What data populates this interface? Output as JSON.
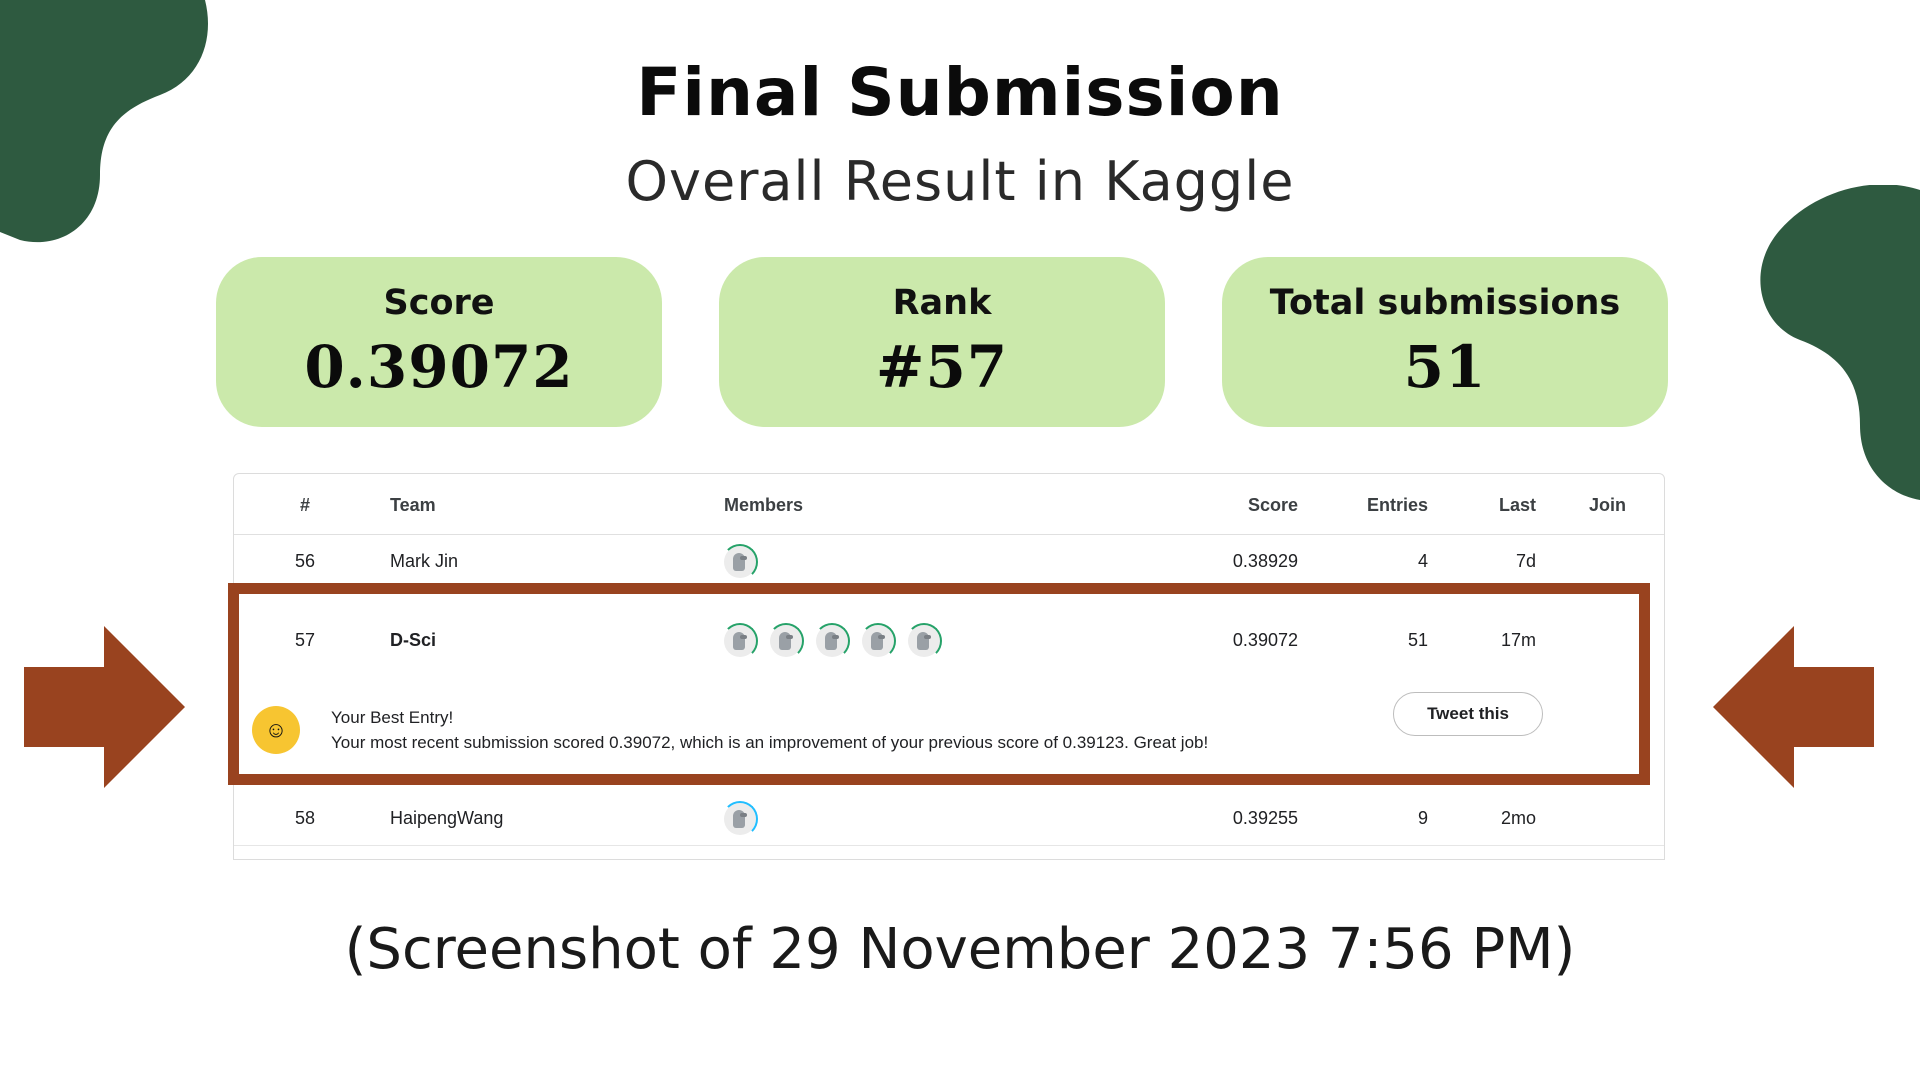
{
  "colors": {
    "background": "#ffffff",
    "blob": "#2e5a40",
    "card": "#cbe9ab",
    "highlight_frame": "#99431f",
    "arrow": "#99431f"
  },
  "header": {
    "title": "Final Submission",
    "subtitle": "Overall Result in Kaggle"
  },
  "cards": [
    {
      "label": "Score",
      "value": "0.39072"
    },
    {
      "label": "Rank",
      "value": "#57"
    },
    {
      "label": "Total submissions",
      "value": "51"
    }
  ],
  "leaderboard": {
    "columns": [
      "#",
      "Team",
      "Members",
      "Score",
      "Entries",
      "Last",
      "Join"
    ],
    "rows": [
      {
        "rank": "56",
        "team": "Mark Jin",
        "members": 1,
        "score": "0.38929",
        "entries": "4",
        "last": "7d"
      },
      {
        "rank": "57",
        "team": "D-Sci",
        "members": 5,
        "score": "0.39072",
        "entries": "51",
        "last": "17m"
      },
      {
        "rank": "58",
        "team": "HaipengWang",
        "members": 1,
        "score": "0.39255",
        "entries": "9",
        "last": "2mo"
      }
    ],
    "best_entry": {
      "icon": "party-face-icon",
      "title": "Your Best Entry!",
      "text": "Your most recent submission scored 0.39072, which is an improvement of your previous score of 0.39123. Great job!",
      "button": "Tweet this"
    }
  },
  "caption": "(Screenshot of 29 November 2023 7:56 PM)"
}
